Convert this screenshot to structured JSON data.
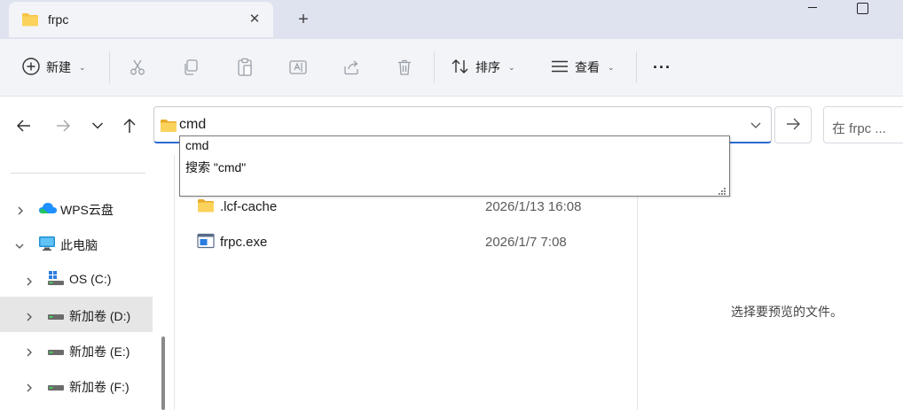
{
  "window": {
    "tab_title": "frpc"
  },
  "toolbar": {
    "new_label": "新建",
    "sort_label": "排序",
    "view_label": "查看",
    "more_label": "···"
  },
  "address": {
    "value": "cmd",
    "search_placeholder": "在 frpc ..."
  },
  "suggestions": [
    {
      "label": "cmd"
    },
    {
      "label": "搜索 \"cmd\""
    }
  ],
  "sidebar": {
    "items": [
      {
        "label": "WPS云盘",
        "icon": "cloud-icon",
        "expanded": false
      },
      {
        "label": "此电脑",
        "icon": "computer-icon",
        "expanded": true
      },
      {
        "label": "OS (C:)",
        "icon": "windows-drive-icon",
        "expanded": false
      },
      {
        "label": "新加卷 (D:)",
        "icon": "drive-icon",
        "expanded": false,
        "selected": true
      },
      {
        "label": "新加卷 (E:)",
        "icon": "drive-icon",
        "expanded": false
      },
      {
        "label": "新加卷 (F:)",
        "icon": "drive-icon",
        "expanded": false
      }
    ]
  },
  "files": [
    {
      "name": ".lcf-cache",
      "date": "2026/1/13 16:08",
      "icon": "folder-icon"
    },
    {
      "name": "frpc.exe",
      "date": "2026/1/7 7:08",
      "icon": "exe-icon"
    }
  ],
  "preview": {
    "empty_text": "选择要预览的文件。"
  },
  "colors": {
    "accent": "#2a6ad1",
    "folder": "#f7c443",
    "titlebar": "#dfe3f0",
    "toolbar": "#f3f4f8"
  }
}
